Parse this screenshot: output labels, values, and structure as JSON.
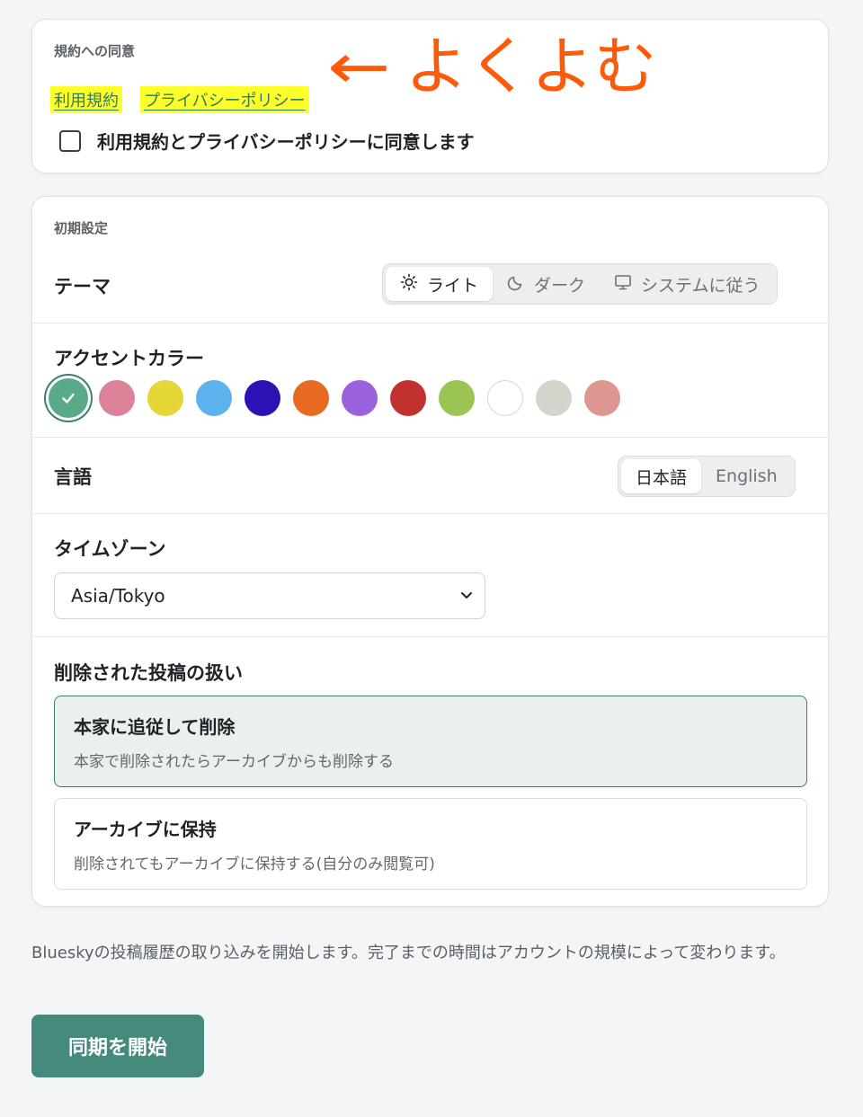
{
  "terms": {
    "section_label": "規約への同意",
    "links": [
      "利用規約",
      "プライバシーポリシー"
    ],
    "annotation_text": "よくよむ",
    "agree_label": "利用規約とプライバシーポリシーに同意します"
  },
  "initial": {
    "section_label": "初期設定",
    "theme": {
      "label": "テーマ",
      "options": [
        {
          "label": "ライト",
          "icon": "sun-icon",
          "active": true
        },
        {
          "label": "ダーク",
          "icon": "moon-icon",
          "active": false
        },
        {
          "label": "システムに従う",
          "icon": "monitor-icon",
          "active": false
        }
      ]
    },
    "accent": {
      "label": "アクセントカラー",
      "colors": [
        "#5aaa8a",
        "#db8299",
        "#e4d634",
        "#5cb2ec",
        "#2c12b5",
        "#e66a22",
        "#9a62de",
        "#c13130",
        "#9cc454",
        "#ffffff",
        "#d5d4cd",
        "#de9690"
      ],
      "selected_index": 0
    },
    "language": {
      "label": "言語",
      "options": [
        {
          "label": "日本語",
          "active": true
        },
        {
          "label": "English",
          "active": false
        }
      ]
    },
    "timezone": {
      "label": "タイムゾーン",
      "value": "Asia/Tokyo"
    },
    "deletion": {
      "label": "削除された投稿の扱い",
      "options": [
        {
          "title": "本家に追従して削除",
          "desc": "本家で削除されたらアーカイブからも削除する",
          "selected": true
        },
        {
          "title": "アーカイブに保持",
          "desc": "削除されてもアーカイブに保持する(自分のみ閲覧可)",
          "selected": false
        }
      ]
    }
  },
  "footer": {
    "note": "Blueskyの投稿履歴の取り込みを開始します。完了までの時間はアカウントの規模によって変わります。",
    "start_button": "同期を開始"
  },
  "colors": {
    "accent": "#468a7e",
    "highlight": "#ffff2a",
    "annotation": "#ff5a0a",
    "selected_bg": "#e9f0ed"
  }
}
